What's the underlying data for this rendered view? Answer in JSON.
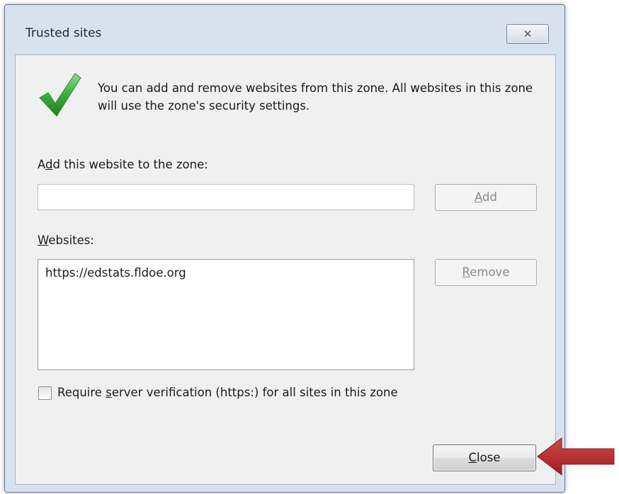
{
  "window": {
    "title": "Trusted sites",
    "close_glyph": "✕"
  },
  "description": "You can add and remove websites from this zone. All websites in this zone will use the zone's security settings.",
  "add_section": {
    "label_prefix": "A",
    "label_accel": "d",
    "label_suffix": "d this website to the zone:",
    "input_value": "",
    "add_button": {
      "accel": "A",
      "rest": "dd"
    }
  },
  "websites_section": {
    "label_accel": "W",
    "label_suffix": "ebsites:",
    "items": [
      "https://edstats.fldoe.org"
    ],
    "remove_button": {
      "accel": "R",
      "rest": "emove"
    }
  },
  "require_verification": {
    "checked": false,
    "label_prefix": "Require ",
    "label_accel": "s",
    "label_suffix": "erver verification (https:) for all sites in this zone"
  },
  "close_button": {
    "accel": "C",
    "rest": "lose"
  },
  "colors": {
    "checkmark": "#3cae3c",
    "arrow": "#b22222"
  },
  "icons": {
    "status": "checkmark-icon",
    "pointer": "red-arrow-icon"
  }
}
